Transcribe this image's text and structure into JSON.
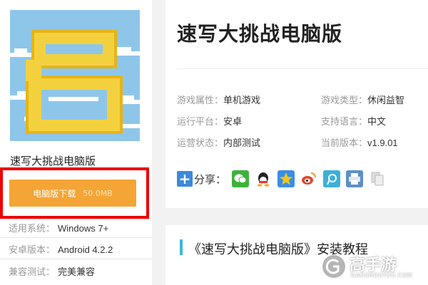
{
  "app": {
    "name": "速写大挑战电脑版",
    "download_label": "电脑版下载",
    "download_size": "50.0MB"
  },
  "meta": [
    {
      "key": "适用系统：",
      "value": "Windows 7+"
    },
    {
      "key": "安卓版本：",
      "value": "Android 4.2.2"
    },
    {
      "key": "兼容测试：",
      "value": "完美兼容"
    }
  ],
  "info": {
    "title": "速写大挑战电脑版",
    "attrs": [
      {
        "key": "游戏属性：",
        "value": "单机游戏"
      },
      {
        "key": "游戏类型：",
        "value": "休闲益智"
      },
      {
        "key": "运行平台：",
        "value": "安卓"
      },
      {
        "key": "支持语言：",
        "value": "中文"
      },
      {
        "key": "运营状态：",
        "value": "内部测试"
      },
      {
        "key": "当前版本：",
        "value": "v1.9.01"
      }
    ],
    "share_label": "分享："
  },
  "share_icons": [
    {
      "name": "wechat-icon",
      "color": "#3db23a"
    },
    {
      "name": "qq-icon",
      "color": "#3a8ee6"
    },
    {
      "name": "qzone-icon",
      "color": "#f3b21a"
    },
    {
      "name": "weibo-icon",
      "color": "#e2452f"
    },
    {
      "name": "tencent-weibo-icon",
      "color": "#3cb0d8"
    },
    {
      "name": "print-icon",
      "color": "#5c8fc6"
    },
    {
      "name": "copy-icon",
      "color": "#c8c8c8"
    }
  ],
  "guide": {
    "title": "《速写大挑战电脑版》安装教程"
  },
  "watermark": {
    "brand": "高手游",
    "url": "GAOSHOUYOU.COM"
  }
}
